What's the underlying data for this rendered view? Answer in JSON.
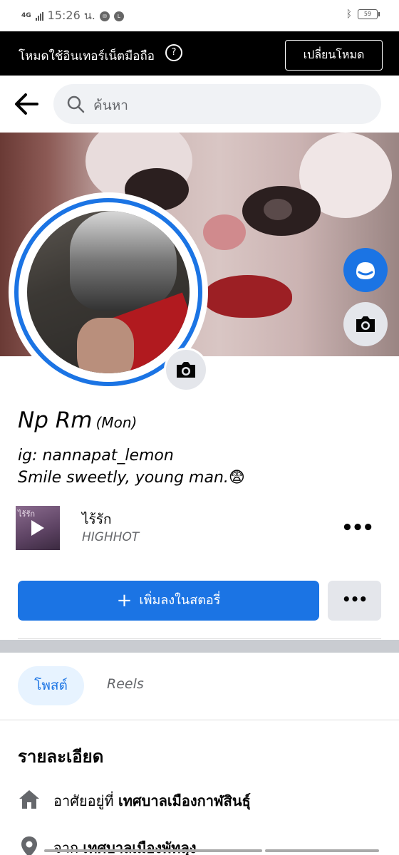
{
  "status_bar": {
    "network": "4G",
    "time": "15:26 น.",
    "battery": "59"
  },
  "mode_banner": {
    "text": "โหมดใช้อินเทอร์เน็ตมือถือ",
    "help_glyph": "?",
    "switch_button": "เปลี่ยนโหมด"
  },
  "search": {
    "placeholder": "ค้นหา"
  },
  "profile": {
    "name": "Np Rm",
    "alt_name": "(Mon)",
    "bio_line1": "ig: nannapat_lemon",
    "bio_line2": "Smile sweetly, young man.😨"
  },
  "music": {
    "art_label": "ไร้รัก",
    "title": "ไร้รัก",
    "artist": "HIGHHOT",
    "more": "•••"
  },
  "actions": {
    "add_story_plus": "+",
    "add_story": "เพิ่มลงในสตอรี่",
    "more": "•••"
  },
  "tabs": {
    "posts": "โพสต์",
    "reels": "Reels"
  },
  "details": {
    "heading": "รายละเอียด",
    "lives_in_prefix": "อาศัยอยู่ที่",
    "lives_in_place": "เทศบาลเมืองกาฬสินธุ์",
    "from_prefix": "จาก",
    "from_place": "เทศบาลเมืองพัทลุง"
  },
  "colors": {
    "accent": "#1b74e4",
    "banner_bg": "#000000",
    "secondary_button": "#e4e6eb"
  }
}
